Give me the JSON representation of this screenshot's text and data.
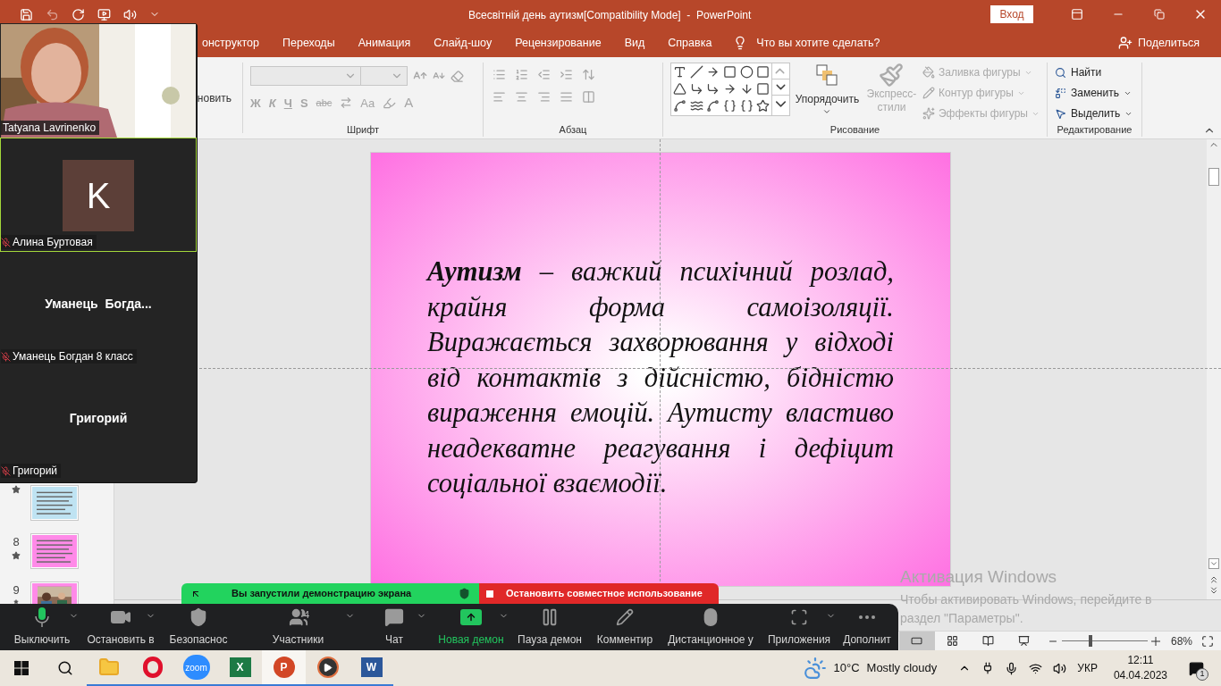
{
  "title_bar": {
    "title": "Всесвітній день аутизм[Compatibility Mode]  -  PowerPoint",
    "sign_in": "Вход"
  },
  "ribbon_tabs": [
    {
      "label": "онструктор",
      "selected": false
    },
    {
      "label": "Переходы",
      "selected": false
    },
    {
      "label": "Анимация",
      "selected": false
    },
    {
      "label": "Слайд-шоу",
      "selected": false
    },
    {
      "label": "Рецензирование",
      "selected": false
    },
    {
      "label": "Вид",
      "selected": false
    },
    {
      "label": "Справка",
      "selected": false
    }
  ],
  "tell_me": "Что вы хотите сделать?",
  "share": "Поделиться",
  "ribbon": {
    "clipboard_fragment": "новить",
    "font_group": {
      "label": "Шрифт",
      "disabled": true,
      "format_buttons": [
        "Ж",
        "К",
        "Ч",
        "S",
        "abc"
      ],
      "case_button": "Aa",
      "color_button": "A"
    },
    "paragraph_group": {
      "label": "Абзац",
      "disabled": true
    },
    "drawing_group": {
      "label": "Рисование",
      "arrange": "Упорядочить",
      "quick_styles": {
        "lines": [
          "Экспресс-",
          "стили"
        ],
        "disabled": true
      },
      "shape_commands": [
        {
          "kind": "fill",
          "label": "Заливка фигуры",
          "disabled": true
        },
        {
          "kind": "outline",
          "label": "Контур фигуры",
          "disabled": true
        },
        {
          "kind": "effects",
          "label": "Эффекты фигуры",
          "disabled": true
        }
      ]
    },
    "editing_group": {
      "label": "Редактирование",
      "commands": [
        {
          "kind": "find",
          "label": "Найти",
          "caret": false
        },
        {
          "kind": "replace",
          "label": "Заменить",
          "caret": true
        },
        {
          "kind": "select",
          "label": "Выделить",
          "caret": true
        }
      ]
    }
  },
  "thumbnails": [
    {
      "color": "#bfe3f2",
      "kind": "text"
    },
    {
      "number": "8",
      "color": "#ff8ae8",
      "kind": "text"
    },
    {
      "number": "9",
      "color": "#ff8ae8"
    }
  ],
  "slide": {
    "body": "**Аутизм** – важкий психічний розлад, крайня форма самоізоляції. Виражається захворювання у відході від контактів з дійсністю, бідністю вираження емоцій. Аутисту властиво неадекватне реагування і дефіцит соціальної взаємодії."
  },
  "activation": {
    "title": "Активация Windows",
    "text": "Чтобы активировать Windows, перейдите в раздел \"Параметры\"."
  },
  "status_bar": {
    "zoom": "68%",
    "zoom_slider": {
      "level": 0.33
    }
  },
  "participants": [
    {
      "kind": "video",
      "label": "Tatyana Lavrinenko",
      "muted": false,
      "speaking": false
    },
    {
      "kind": "avatar",
      "initial": "K",
      "label": "Алина Буртовая",
      "muted": true,
      "speaking": true
    },
    {
      "kind": "name",
      "display": "Уманець  Богда...",
      "label": "Уманець Богдан 8 класс",
      "muted": true,
      "speaking": false
    },
    {
      "kind": "name",
      "display": "Григорий",
      "label": "Григорий",
      "muted": true,
      "speaking": false
    }
  ],
  "share_banner": {
    "status": "Вы запустили демонстрацию экрана",
    "stop": "Остановить совместное использование"
  },
  "meeting_toolbar": [
    {
      "kind": "mic",
      "label": "Выключить",
      "caret": true,
      "highlighted": false
    },
    {
      "kind": "camera",
      "label": "Остановить в",
      "caret": true,
      "highlighted": false
    },
    {
      "kind": "security",
      "label": "Безопаснос",
      "caret": false,
      "highlighted": false
    },
    {
      "kind": "participants",
      "label": "Участники",
      "badge": "4",
      "caret": true,
      "highlighted": false
    },
    {
      "kind": "chat",
      "label": "Чат",
      "caret": true,
      "highlighted": false
    },
    {
      "kind": "share",
      "label": "Новая демон",
      "caret": true,
      "highlighted": true
    },
    {
      "kind": "pause",
      "label": "Пауза демон",
      "caret": false,
      "highlighted": false
    },
    {
      "kind": "annotate",
      "label": "Комментир",
      "caret": false,
      "highlighted": false
    },
    {
      "kind": "remote",
      "label": "Дистанционное у",
      "caret": false,
      "highlighted": false
    },
    {
      "kind": "apps",
      "label": "Приложения",
      "caret": true,
      "highlighted": false
    },
    {
      "kind": "more",
      "label": "Дополнит",
      "caret": false,
      "highlighted": false
    }
  ],
  "taskbar": {
    "apps": [
      {
        "kind": "explorer",
        "selected": false
      },
      {
        "kind": "opera",
        "selected": false
      },
      {
        "kind": "zoom",
        "glyph": "zoom",
        "selected": false
      },
      {
        "kind": "excel",
        "glyph": "X",
        "selected": false
      },
      {
        "kind": "powerpoint",
        "glyph": "P",
        "selected": true
      },
      {
        "kind": "player",
        "selected": false
      },
      {
        "kind": "word",
        "glyph": "W",
        "selected": false
      }
    ],
    "weather": {
      "temp": "10°C",
      "text": "Mostly cloudy"
    },
    "language": "УКР",
    "time": "12:11",
    "date": "04.04.2023",
    "notifications": "1"
  }
}
